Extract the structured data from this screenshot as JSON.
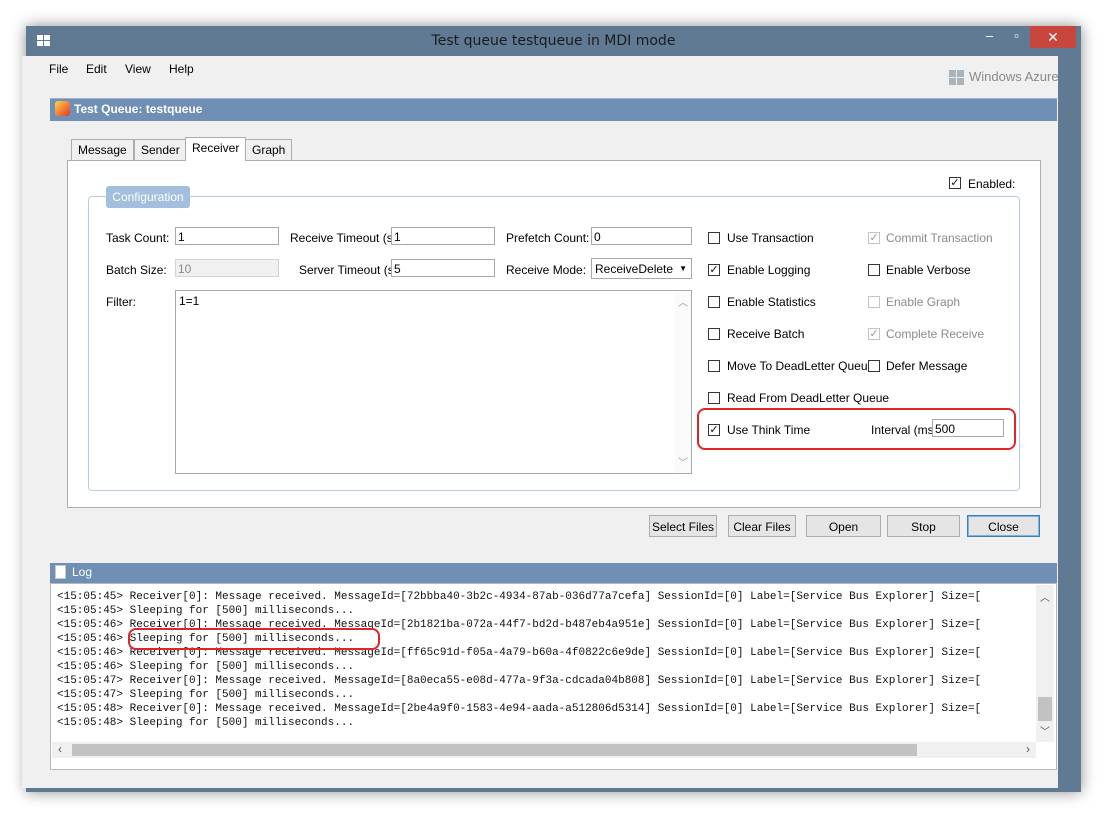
{
  "window": {
    "title": "Test queue testqueue in MDI mode",
    "minimize": "–",
    "maximize": "▫",
    "close": "✕"
  },
  "menu": {
    "file": "File",
    "edit": "Edit",
    "view": "View",
    "help": "Help"
  },
  "brand": "Windows Azure",
  "child": {
    "title": "Test Queue: testqueue"
  },
  "tabs": [
    "Message",
    "Sender",
    "Receiver",
    "Graph"
  ],
  "active_tab": "Receiver",
  "enabled": {
    "label": "Enabled:",
    "checked": true
  },
  "config": {
    "legend": "Configuration",
    "task_count_label": "Task Count:",
    "task_count": "1",
    "receive_timeout_label": "Receive Timeout (s):",
    "receive_timeout": "1",
    "prefetch_label": "Prefetch Count:",
    "prefetch": "0",
    "batch_size_label": "Batch Size:",
    "batch_size": "10",
    "server_timeout_label": "Server Timeout (s):",
    "server_timeout": "5",
    "receive_mode_label": "Receive Mode:",
    "receive_mode": "ReceiveDelete",
    "filter_label": "Filter:",
    "filter": "1=1"
  },
  "options": {
    "use_transaction": "Use Transaction",
    "commit_transaction": "Commit Transaction",
    "enable_logging": "Enable Logging",
    "enable_verbose": "Enable Verbose",
    "enable_statistics": "Enable Statistics",
    "enable_graph": "Enable Graph",
    "receive_batch": "Receive Batch",
    "complete_receive": "Complete Receive",
    "move_to_deadletter": "Move To DeadLetter Queue",
    "defer_message": "Defer Message",
    "read_from_deadletter": "Read From DeadLetter Queue",
    "use_think_time": "Use Think Time",
    "interval_label": "Interval (ms):",
    "interval": "500"
  },
  "buttons": {
    "select_files": "Select Files",
    "clear_files": "Clear Files",
    "open": "Open",
    "stop": "Stop",
    "close": "Close"
  },
  "log": {
    "title": "Log",
    "lines": [
      "<15:05:45> Receiver[0]: Message received. MessageId=[72bbba40-3b2c-4934-87ab-036d77a7cefa] SessionId=[0] Label=[Service Bus Explorer] Size=[",
      "<15:05:45> Sleeping for [500] milliseconds...",
      "<15:05:46> Receiver[0]: Message received. MessageId=[2b1821ba-072a-44f7-bd2d-b487eb4a951e] SessionId=[0] Label=[Service Bus Explorer] Size=[",
      "<15:05:46> Sleeping for [500] milliseconds...",
      "<15:05:46> Receiver[0]: Message received. MessageId=[ff65c91d-f05a-4a79-b60a-4f0822c6e9de] SessionId=[0] Label=[Service Bus Explorer] Size=[",
      "<15:05:46> Sleeping for [500] milliseconds...",
      "<15:05:47> Receiver[0]: Message received. MessageId=[8a0eca55-e08d-477a-9f3a-cdcada04b808] SessionId=[0] Label=[Service Bus Explorer] Size=[",
      "<15:05:47> Sleeping for [500] milliseconds...",
      "<15:05:48> Receiver[0]: Message received. MessageId=[2be4a9f0-1583-4e94-aada-a512806d5314] SessionId=[0] Label=[Service Bus Explorer] Size=[",
      "<15:05:48> Sleeping for [500] milliseconds..."
    ]
  }
}
